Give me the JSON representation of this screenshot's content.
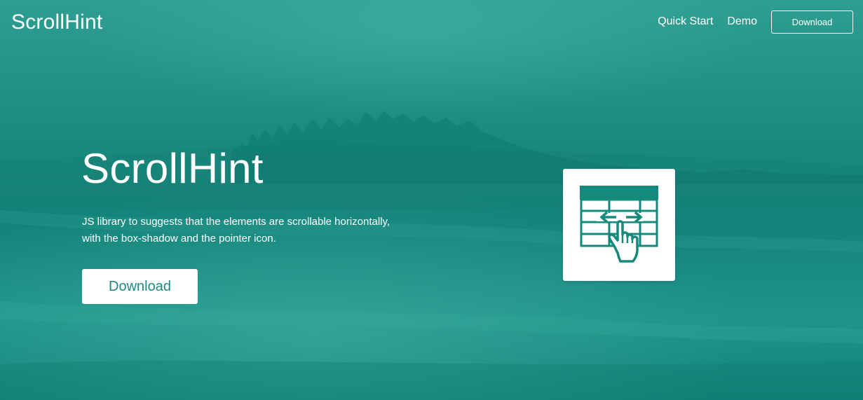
{
  "nav": {
    "brand": "ScrollHint",
    "links": [
      {
        "label": "Quick Start"
      },
      {
        "label": "Demo"
      }
    ],
    "download_label": "Download"
  },
  "hero": {
    "title": "ScrollHint",
    "description": "JS library to suggests that the elements are scrollable horizontally, with the box-shadow and the pointer icon.",
    "download_label": "Download",
    "logo_icon": "table-scroll-pointer-icon"
  },
  "colors": {
    "accent": "#16897d",
    "background": "#1a8a7e",
    "text": "#ffffff"
  }
}
